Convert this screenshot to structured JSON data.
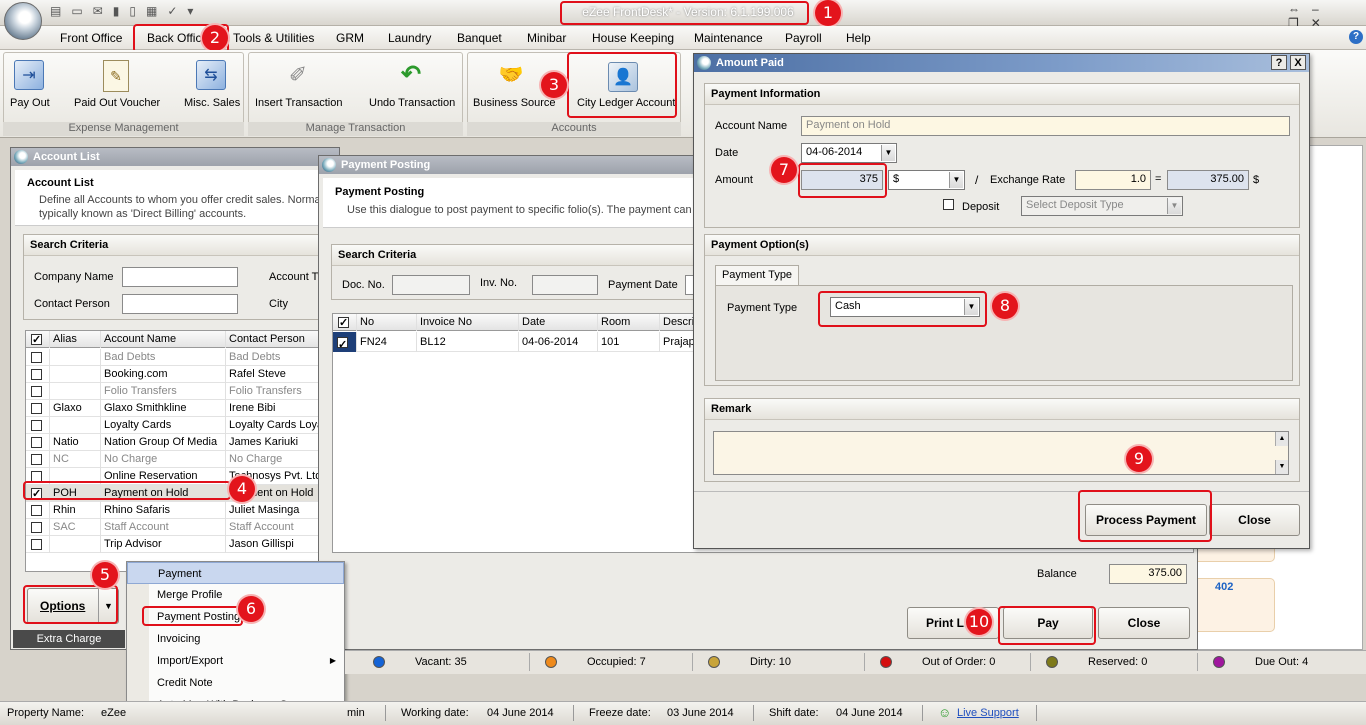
{
  "app": {
    "title": "eZee FrontDesk* - Version: 6.1.199.006"
  },
  "menu": [
    "Front Office",
    "Back Office",
    "Tools & Utilities",
    "GRM",
    "Laundry",
    "Banquet",
    "Minibar",
    "House Keeping",
    "Maintenance",
    "Payroll",
    "Help"
  ],
  "ribbon": {
    "buttons": [
      "Pay Out",
      "Paid Out Voucher",
      "Misc. Sales",
      "Insert Transaction",
      "Undo Transaction",
      "Business Source",
      "City Ledger Account"
    ],
    "groups": [
      "Expense Management",
      "Manage Transaction",
      "Accounts"
    ]
  },
  "account_list": {
    "title": "Account List",
    "heading": "Account List",
    "desc1": "Define all Accounts to whom you offer credit sales. Norma",
    "desc2": "typically known as 'Direct Billing' accounts.",
    "search_title": "Search Criteria",
    "company_label": "Company Name",
    "contact_label": "Contact Person",
    "acctype_label": "Account Ty",
    "city_label": "City",
    "columns": [
      "Alias",
      "Account Name",
      "Contact Person"
    ],
    "rows": [
      {
        "alias": "",
        "name": "Bad Debts",
        "contact": "Bad Debts",
        "gray": true,
        "checked": false
      },
      {
        "alias": "",
        "name": "Booking.com",
        "contact": "Rafel Steve",
        "gray": false,
        "checked": false
      },
      {
        "alias": "",
        "name": "Folio Transfers",
        "contact": "Folio Transfers",
        "gray": true,
        "checked": false
      },
      {
        "alias": "Glaxo",
        "name": "Glaxo Smithkline",
        "contact": "Irene Bibi",
        "gray": false,
        "checked": false
      },
      {
        "alias": "",
        "name": "Loyalty Cards",
        "contact": "Loyalty Cards Loya",
        "gray": false,
        "checked": false
      },
      {
        "alias": "Natio",
        "name": "Nation Group Of Media",
        "contact": "James Kariuki",
        "gray": false,
        "checked": false
      },
      {
        "alias": "NC",
        "name": "No Charge",
        "contact": "No Charge",
        "gray": true,
        "checked": false
      },
      {
        "alias": "",
        "name": "Online Reservation",
        "contact": "Technosys Pvt. Ltd",
        "gray": false,
        "checked": false
      },
      {
        "alias": "POH",
        "name": "Payment on Hold",
        "contact": "Payment on Hold",
        "gray": false,
        "checked": true
      },
      {
        "alias": "Rhin",
        "name": "Rhino Safaris",
        "contact": "Juliet Masinga",
        "gray": false,
        "checked": false
      },
      {
        "alias": "SAC",
        "name": "Staff Account",
        "contact": "Staff Account",
        "gray": true,
        "checked": false
      },
      {
        "alias": "",
        "name": "Trip Advisor",
        "contact": "Jason Gillispi",
        "gray": false,
        "checked": false
      }
    ],
    "options_label": "Options",
    "extra_charge": "Extra Charge"
  },
  "options_menu": [
    "Payment",
    "Merge Profile",
    "Payment Posting",
    "Invoicing",
    "Import/Export",
    "Credit Note",
    "Auto Map With Business Source"
  ],
  "payment_posting": {
    "title": "Payment Posting",
    "heading": "Payment Posting",
    "desc": "Use this dialogue to post payment to specific folio(s). The payment can b",
    "search_title": "Search Criteria",
    "doc_label": "Doc. No.",
    "inv_label": "Inv. No.",
    "paydate_label": "Payment Date",
    "columns": [
      "No",
      "Invoice No",
      "Date",
      "Room",
      "Descri"
    ],
    "rows": [
      {
        "no": "FN24",
        "invoice": "BL12",
        "date": "04-06-2014",
        "room": "101",
        "desc": "Prajap"
      }
    ],
    "balance_label": "Balance",
    "balance": "375.00",
    "print_label": "Print Li",
    "pay_label": "Pay",
    "close_label": "Close"
  },
  "amount_paid": {
    "title": "Amount Paid",
    "info_title": "Payment Information",
    "account_label": "Account Name",
    "account_value": "Payment on Hold",
    "date_label": "Date",
    "date_value": "04-06-2014",
    "amount_label": "Amount",
    "amount_value": "375",
    "currency": "$",
    "slash": "/",
    "exrate_label": "Exchange Rate",
    "exrate_value": "1.0",
    "equals": "=",
    "converted": "375.00",
    "converted_cur": "$",
    "deposit_label": "Deposit",
    "deposit_type_placeholder": "Select Deposit Type",
    "options_title": "Payment Option(s)",
    "ptype_tab": "Payment Type",
    "ptype_label": "Payment Type",
    "ptype_value": "Cash",
    "remark_title": "Remark",
    "process_label": "Process Payment",
    "close_label": "Close",
    "help": "?",
    "close_x": "X"
  },
  "right_tile": {
    "room": "402"
  },
  "status": [
    {
      "label": "Vacant: 35",
      "color": "#1463d6"
    },
    {
      "label": "Occupied: 7",
      "color": "#ef8a1c"
    },
    {
      "label": "Dirty: 10",
      "color": "#c8a43a"
    },
    {
      "label": "Out of Order: 0",
      "color": "#d40f0f"
    },
    {
      "label": "Reserved: 0",
      "color": "#7e7a1a"
    },
    {
      "label": "Due Out: 4",
      "color": "#a0169e"
    }
  ],
  "footer": {
    "property_label": "Property Name:",
    "property_value": "eZee",
    "admin": "min",
    "working_label": "Working date:",
    "working_value": "04 June 2014",
    "freeze_label": "Freeze date:",
    "freeze_value": "03 June 2014",
    "shift_label": "Shift date:",
    "shift_value": "04 June 2014",
    "live_support": "Live Support"
  },
  "badges": [
    "1",
    "2",
    "3",
    "4",
    "5",
    "6",
    "7",
    "8",
    "9",
    "10"
  ]
}
